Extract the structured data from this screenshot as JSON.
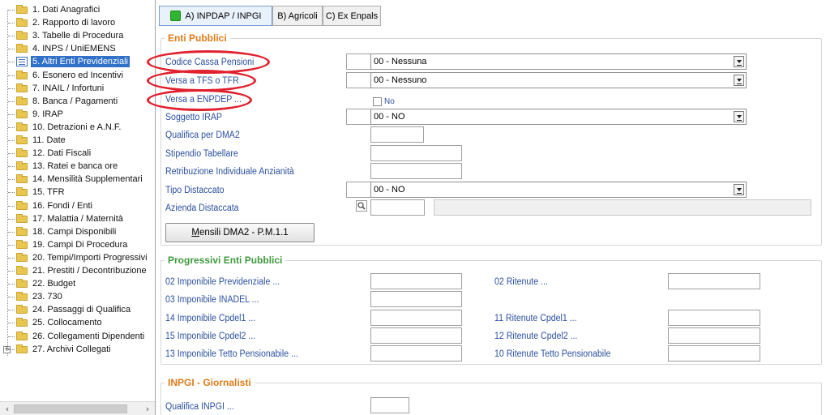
{
  "sidebar": {
    "items": [
      {
        "label": "1. Dati Anagrafici",
        "selected": false
      },
      {
        "label": "2. Rapporto di lavoro",
        "selected": false
      },
      {
        "label": "3. Tabelle di Procedura",
        "selected": false
      },
      {
        "label": "4. INPS / UniEMENS",
        "selected": false
      },
      {
        "label": "5. Altri Enti Previdenziali",
        "selected": true
      },
      {
        "label": "6. Esonero ed Incentivi",
        "selected": false
      },
      {
        "label": "7. INAIL / Infortuni",
        "selected": false
      },
      {
        "label": "8. Banca / Pagamenti",
        "selected": false
      },
      {
        "label": "9. IRAP",
        "selected": false
      },
      {
        "label": "10. Detrazioni e A.N.F.",
        "selected": false
      },
      {
        "label": "11. Date",
        "selected": false
      },
      {
        "label": "12. Dati Fiscali",
        "selected": false
      },
      {
        "label": "13. Ratei e banca ore",
        "selected": false
      },
      {
        "label": "14. Mensilità Supplementari",
        "selected": false
      },
      {
        "label": "15. TFR",
        "selected": false
      },
      {
        "label": "16. Fondi / Enti",
        "selected": false
      },
      {
        "label": "17. Malattia / Maternità",
        "selected": false
      },
      {
        "label": "18. Campi Disponibili",
        "selected": false
      },
      {
        "label": "19. Campi Di Procedura",
        "selected": false
      },
      {
        "label": "20. Tempi/Importi Progressivi",
        "selected": false
      },
      {
        "label": "21. Prestiti / Decontribuzione",
        "selected": false
      },
      {
        "label": "22. Budget",
        "selected": false
      },
      {
        "label": "23. 730",
        "selected": false
      },
      {
        "label": "24. Passaggi di Qualifica",
        "selected": false
      },
      {
        "label": "25. Collocamento",
        "selected": false
      },
      {
        "label": "26. Collegamenti Dipendenti",
        "selected": false
      },
      {
        "label": "27. Archivi Collegati",
        "selected": false,
        "expandable": true
      }
    ],
    "scroll_left": "‹",
    "scroll_right": "›"
  },
  "tabs": [
    {
      "label": "A) INPDAP / INPGI",
      "active": true
    },
    {
      "label": "B) Agricoli",
      "active": false
    },
    {
      "label": "C) Ex Enpals",
      "active": false
    }
  ],
  "enti_pubblici": {
    "title": "Enti Pubblici",
    "codice_cassa": {
      "label": "Codice Cassa Pensioni",
      "value": "00 - Nessuna"
    },
    "versa_tfs": {
      "label": "Versa a TFS o TFR",
      "value": "00 - Nessuno"
    },
    "versa_enpdep": {
      "label": "Versa a ENPDEP ...",
      "checkbox_label": "No",
      "checked": false
    },
    "soggetto_irap": {
      "label": "Soggetto IRAP",
      "value": "00 - NO"
    },
    "qualifica_dma2": {
      "label": "Qualifica per DMA2",
      "value": ""
    },
    "stipendio": {
      "label": "Stipendio Tabellare",
      "value": ""
    },
    "retribuzione": {
      "label": "Retribuzione Individuale Anzianità",
      "value": ""
    },
    "tipo_distaccato": {
      "label": "Tipo Distaccato",
      "value": "00 - NO"
    },
    "azienda_distaccata": {
      "label": "Azienda Distaccata",
      "code": "",
      "description": ""
    },
    "mensili_button": "Mensili DMA2 - P.M.1.1"
  },
  "progressivi": {
    "title": "Progressivi Enti Pubblici",
    "left": [
      {
        "label": "02 Imponibile Previdenziale ...",
        "value": ""
      },
      {
        "label": "03 Imponibile INADEL ...",
        "value": ""
      },
      {
        "label": "14 Imponibile Cpdel1 ...",
        "value": ""
      },
      {
        "label": "15 Imponibile Cpdel2 ...",
        "value": ""
      },
      {
        "label": "13 Imponibile Tetto Pensionabile ...",
        "value": ""
      }
    ],
    "right": [
      {
        "label": "02 Ritenute ...",
        "value": ""
      },
      {
        "label": "11 Ritenute Cpdel1 ...",
        "value": ""
      },
      {
        "label": "12 Ritenute Cpdel2 ...",
        "value": ""
      },
      {
        "label": "10 Ritenute Tetto Pensionabile",
        "value": ""
      }
    ]
  },
  "inpgi": {
    "title": "INPGI - Giornalisti",
    "qualifica": {
      "label": "Qualifica INPGI ...",
      "value": ""
    }
  },
  "colors": {
    "group_title_orange": "#e07b1a",
    "group_title_green": "#3e9a3e",
    "label_blue": "#2b4fa0",
    "selection_blue": "#3170c7",
    "annotation_red": "#e0222f"
  }
}
